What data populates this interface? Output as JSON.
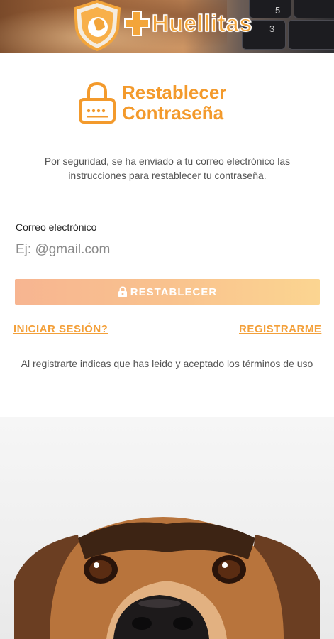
{
  "header": {
    "brand_name": "Huellitas",
    "keys": [
      "5",
      "3"
    ]
  },
  "main": {
    "title_line1": "Restablecer",
    "title_line2": "Contraseña",
    "description": "Por seguridad, se ha enviado a tu correo electrónico las instrucciones para restablecer tu contraseña.",
    "email_label": "Correo electrónico",
    "email_placeholder": "Ej: @gmail.com",
    "email_value": "",
    "reset_button_label": "RESTABLECER",
    "login_link": "INICIAR SESIÓN?",
    "register_link": "REGISTRARME",
    "terms_text": "Al registrarte indicas que has leido y aceptado los términos de uso"
  },
  "colors": {
    "accent": "#f39a2c",
    "button_gradient_start": "#f7b591",
    "button_gradient_end": "#fbd591",
    "text_muted": "#555555"
  },
  "icons": [
    "shield-dog-icon",
    "plus-icon",
    "lock-icon",
    "lock-small-icon"
  ]
}
